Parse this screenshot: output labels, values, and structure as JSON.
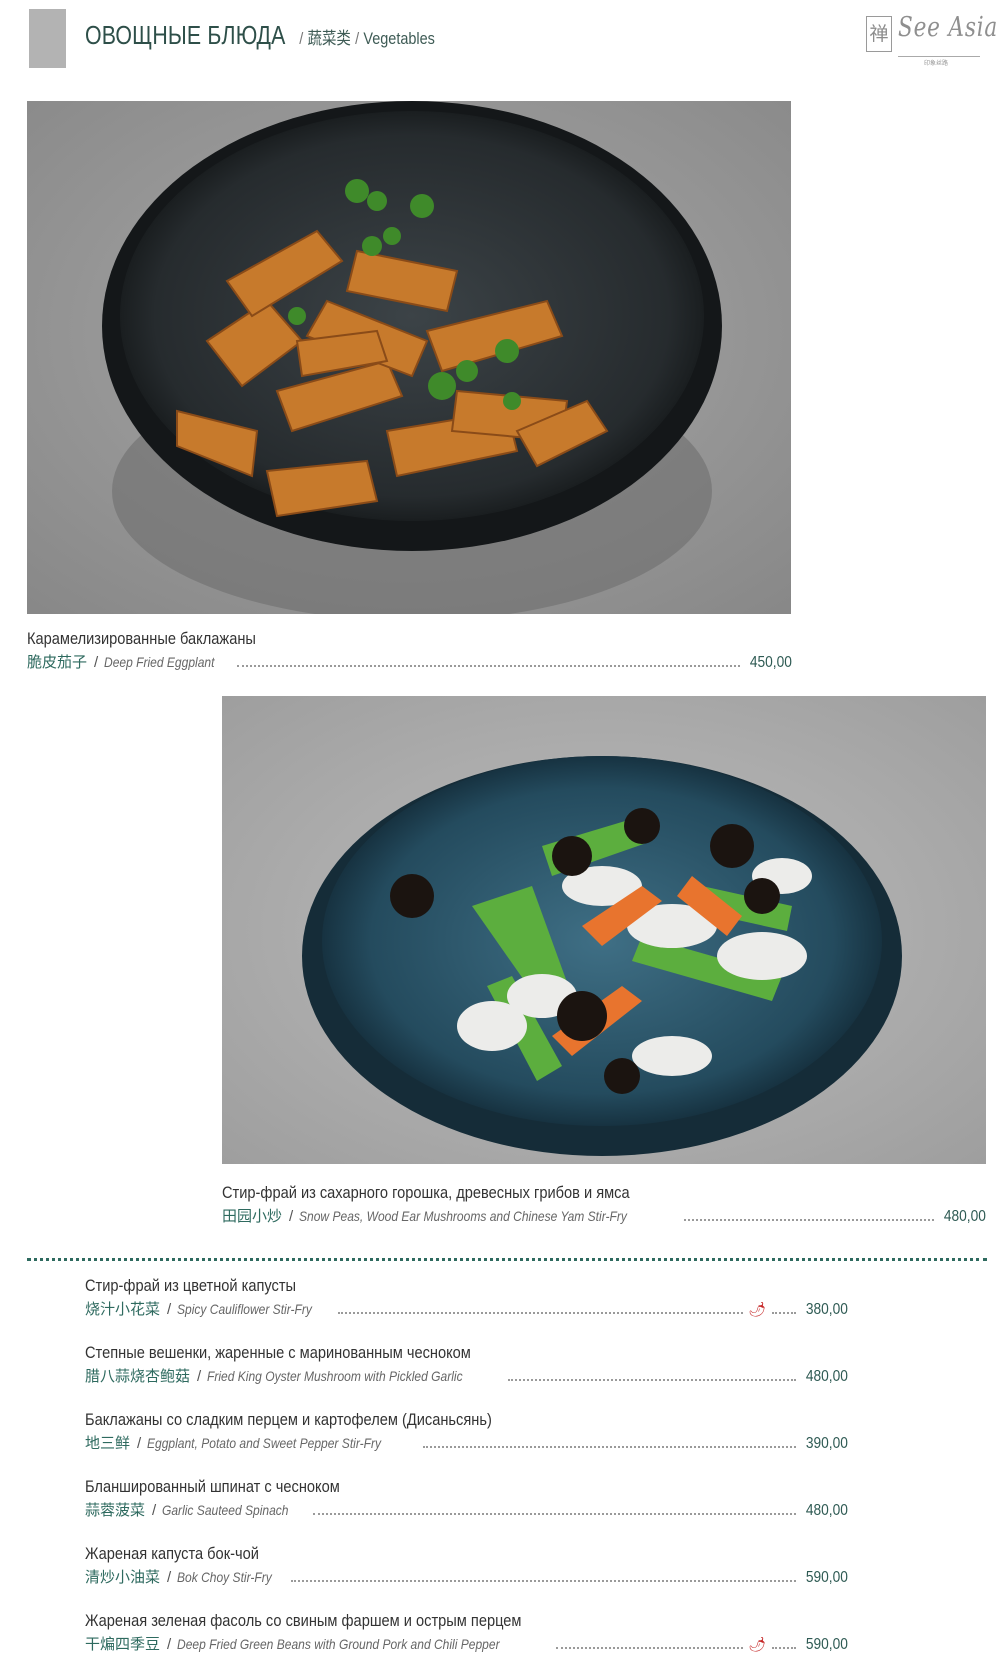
{
  "header": {
    "title": "ОВОЩНЫЕ БЛЮДА",
    "subtitle_cn": "蔬菜类",
    "subtitle_en": "Vegetables",
    "separator": "/"
  },
  "logo": {
    "mark": "禅",
    "name": "See Asia",
    "tagline": "印象丝路"
  },
  "featured": [
    {
      "name_ru": "Карамелизированные баклажаны",
      "name_cn": "脆皮茄子",
      "name_en": "Deep Fried Eggplant",
      "price": "450,00"
    },
    {
      "name_ru": "Стир-фрай из сахарного горошка, древесных грибов и ямса",
      "name_cn": "田园小炒",
      "name_en": "Snow Peas, Wood Ear Mushrooms and Chinese Yam Stir-Fry",
      "price": "480,00"
    }
  ],
  "dishes": [
    {
      "name_ru": "Стир-фрай из цветной капусты",
      "name_cn": "烧汁小花菜",
      "name_en": "Spicy Cauliflower Stir-Fry",
      "price": "380,00",
      "spicy": true
    },
    {
      "name_ru": "Степные вешенки, жаренные с маринованным чесноком",
      "name_cn": "腊八蒜烧杏鲍菇",
      "name_en": "Fried King Oyster Mushroom with Pickled Garlic",
      "price": "480,00",
      "spicy": false
    },
    {
      "name_ru": "Баклажаны со сладким перцем и картофелем (Дисаньсянь)",
      "name_cn": "地三鲜",
      "name_en": "Eggplant, Potato and Sweet Pepper Stir-Fry",
      "price": "390,00",
      "spicy": false
    },
    {
      "name_ru": "Бланшированный шпинат с чесноком",
      "name_cn": "蒜蓉菠菜",
      "name_en": "Garlic Sauteed Spinach",
      "price": "480,00",
      "spicy": false
    },
    {
      "name_ru": "Жареная капуста бок-чой",
      "name_cn": "清炒小油菜",
      "name_en": "Bok Choy Stir-Fry",
      "price": "590,00",
      "spicy": false
    },
    {
      "name_ru": "Жареная зеленая фасоль со свиным фаршем и острым перцем",
      "name_cn": "干煸四季豆",
      "name_en": "Deep Fried Green Beans with Ground Pork and Chili Pepper",
      "price": "590,00",
      "spicy": true
    }
  ],
  "icons": {
    "spicy": "chili-icon"
  },
  "colors": {
    "accent": "#2e6a5f",
    "title": "#2e4f49"
  }
}
